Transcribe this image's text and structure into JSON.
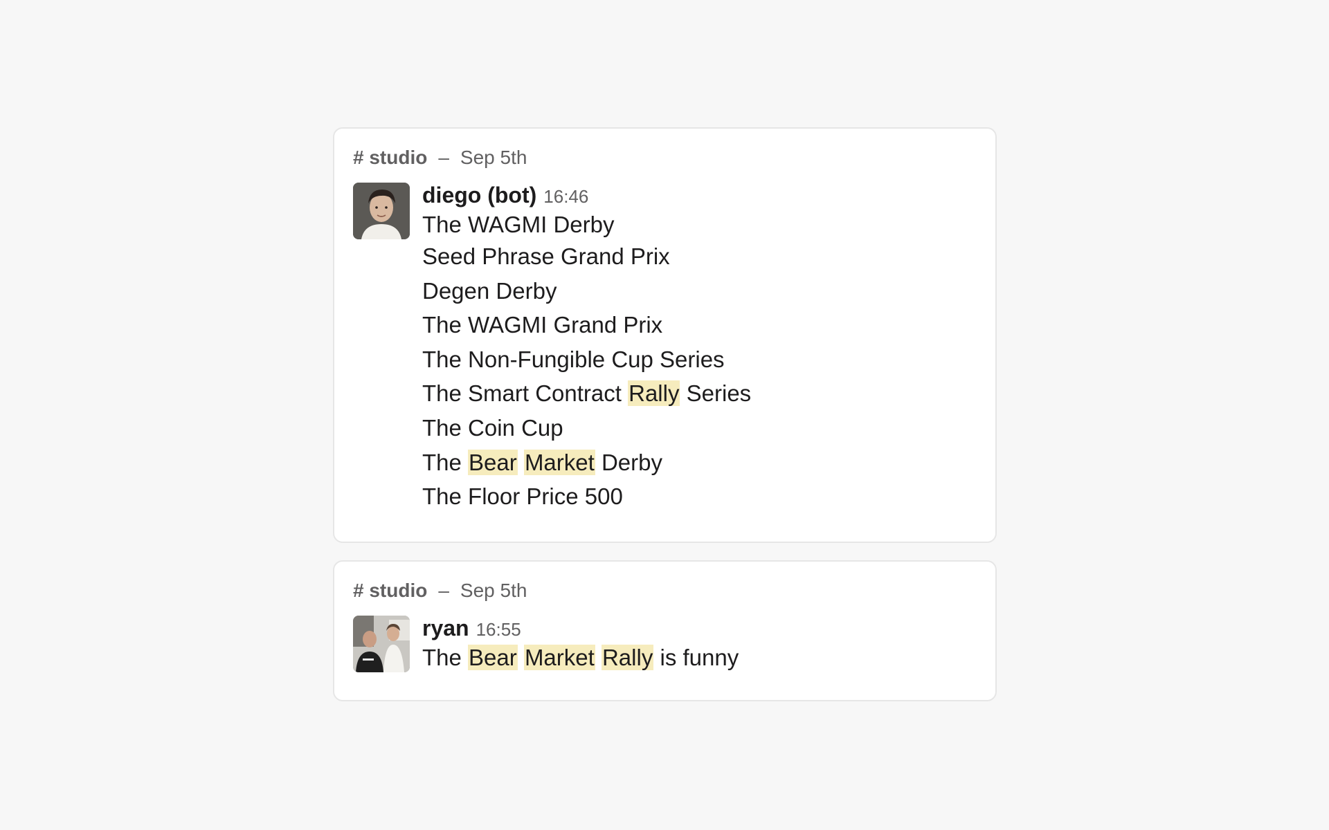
{
  "messages": [
    {
      "channel": "# studio",
      "separator": "–",
      "date": "Sep 5th",
      "author": "diego (bot)",
      "time": "16:46",
      "lines": [
        [
          {
            "t": "The WAGMI Derby"
          }
        ],
        [
          {
            "t": "Seed Phrase Grand Prix"
          }
        ],
        [
          {
            "t": "Degen Derby"
          }
        ],
        [
          {
            "t": "The WAGMI Grand Prix"
          }
        ],
        [
          {
            "t": "The Non-Fungible Cup Series"
          }
        ],
        [
          {
            "t": "The Smart Contract "
          },
          {
            "t": "Rally",
            "hl": true
          },
          {
            "t": " Series"
          }
        ],
        [
          {
            "t": "The Coin Cup"
          }
        ],
        [
          {
            "t": "The "
          },
          {
            "t": "Bear",
            "hl": true
          },
          {
            "t": " "
          },
          {
            "t": "Market",
            "hl": true
          },
          {
            "t": " Derby"
          }
        ],
        [
          {
            "t": "The Floor Price 500"
          }
        ]
      ]
    },
    {
      "channel": "# studio",
      "separator": "–",
      "date": "Sep 5th",
      "author": "ryan",
      "time": "16:55",
      "lines": [
        [
          {
            "t": "The "
          },
          {
            "t": "Bear",
            "hl": true
          },
          {
            "t": " "
          },
          {
            "t": "Market",
            "hl": true
          },
          {
            "t": " "
          },
          {
            "t": "Rally",
            "hl": true
          },
          {
            "t": " is funny"
          }
        ]
      ]
    }
  ],
  "colors": {
    "background": "#f7f7f7",
    "card": "#ffffff",
    "highlight": "#f6ecbd",
    "meta_text": "#616061",
    "text": "#1d1c1d"
  }
}
